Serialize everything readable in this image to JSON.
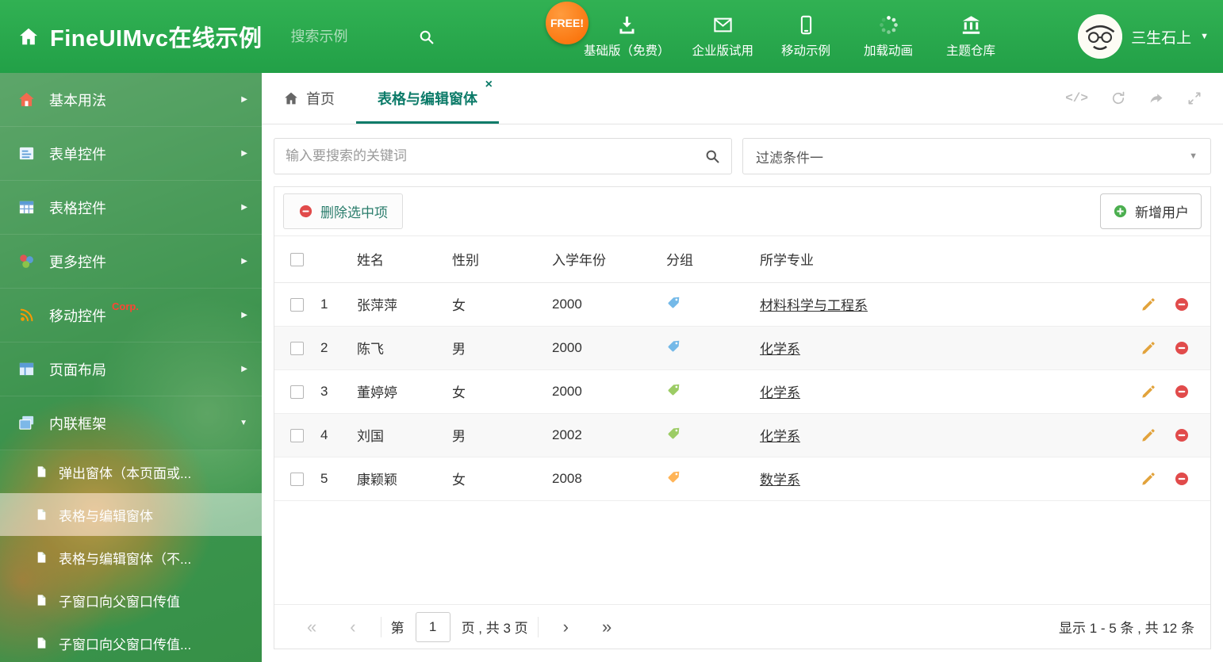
{
  "colors": {
    "header_green": "#27a44a",
    "accent_teal": "#0c7b69",
    "free_badge_orange": "#f96a00",
    "delete_red": "#e14b4b",
    "add_green": "#4caf50",
    "edit_yellow": "#e2a33c"
  },
  "header": {
    "brand": "FineUIMvc在线示例",
    "search_placeholder": "搜索示例",
    "free_badge": "FREE!",
    "nav_items": [
      {
        "label": "基础版（免费）",
        "icon": "download-icon"
      },
      {
        "label": "企业版试用",
        "icon": "envelope-icon"
      },
      {
        "label": "移动示例",
        "icon": "mobile-icon"
      },
      {
        "label": "加载动画",
        "icon": "spinner-icon"
      },
      {
        "label": "主题仓库",
        "icon": "bank-icon"
      }
    ],
    "user_name": "三生石上"
  },
  "sidebar": {
    "items": [
      {
        "label": "基本用法",
        "icon": "home-colored-icon",
        "arrow": "right"
      },
      {
        "label": "表单控件",
        "icon": "form-icon",
        "arrow": "right"
      },
      {
        "label": "表格控件",
        "icon": "table-icon",
        "arrow": "right"
      },
      {
        "label": "更多控件",
        "icon": "blocks-icon",
        "arrow": "right"
      },
      {
        "label": "移动控件",
        "icon": "signal-icon",
        "badge": "Corp.",
        "arrow": "right"
      },
      {
        "label": "页面布局",
        "icon": "layout-icon",
        "arrow": "right"
      },
      {
        "label": "内联框架",
        "icon": "frames-icon",
        "arrow": "down"
      }
    ],
    "subitems": [
      {
        "label": "弹出窗体（本页面或...",
        "active": false
      },
      {
        "label": "表格与编辑窗体",
        "active": true
      },
      {
        "label": "表格与编辑窗体（不...",
        "active": false
      },
      {
        "label": "子窗口向父窗口传值",
        "active": false
      },
      {
        "label": "子窗口向父窗口传值...",
        "active": false
      }
    ]
  },
  "tabs": {
    "home": "首页",
    "active": "表格与编辑窗体"
  },
  "filters": {
    "search_placeholder": "输入要搜索的关键词",
    "filter_selected": "过滤条件一"
  },
  "toolbar": {
    "delete_label": "删除选中项",
    "add_label": "新增用户"
  },
  "table": {
    "columns": [
      "姓名",
      "性别",
      "入学年份",
      "分组",
      "所学专业"
    ],
    "rows": [
      {
        "num": "1",
        "name": "张萍萍",
        "gender": "女",
        "year": "2000",
        "tag_color": "#74b9e8",
        "major": "材料科学与工程系"
      },
      {
        "num": "2",
        "name": "陈飞",
        "gender": "男",
        "year": "2000",
        "tag_color": "#74b9e8",
        "major": "化学系"
      },
      {
        "num": "3",
        "name": "董婷婷",
        "gender": "女",
        "year": "2000",
        "tag_color": "#9ccc65",
        "major": "化学系"
      },
      {
        "num": "4",
        "name": "刘国",
        "gender": "男",
        "year": "2002",
        "tag_color": "#9ccc65",
        "major": "化学系"
      },
      {
        "num": "5",
        "name": "康颖颖",
        "gender": "女",
        "year": "2008",
        "tag_color": "#ffb457",
        "major": "数学系"
      }
    ]
  },
  "pagination": {
    "prefix": "第",
    "page": "1",
    "suffix": "页 , 共 3 页",
    "summary": "显示 1 - 5 条 , 共 12 条"
  }
}
